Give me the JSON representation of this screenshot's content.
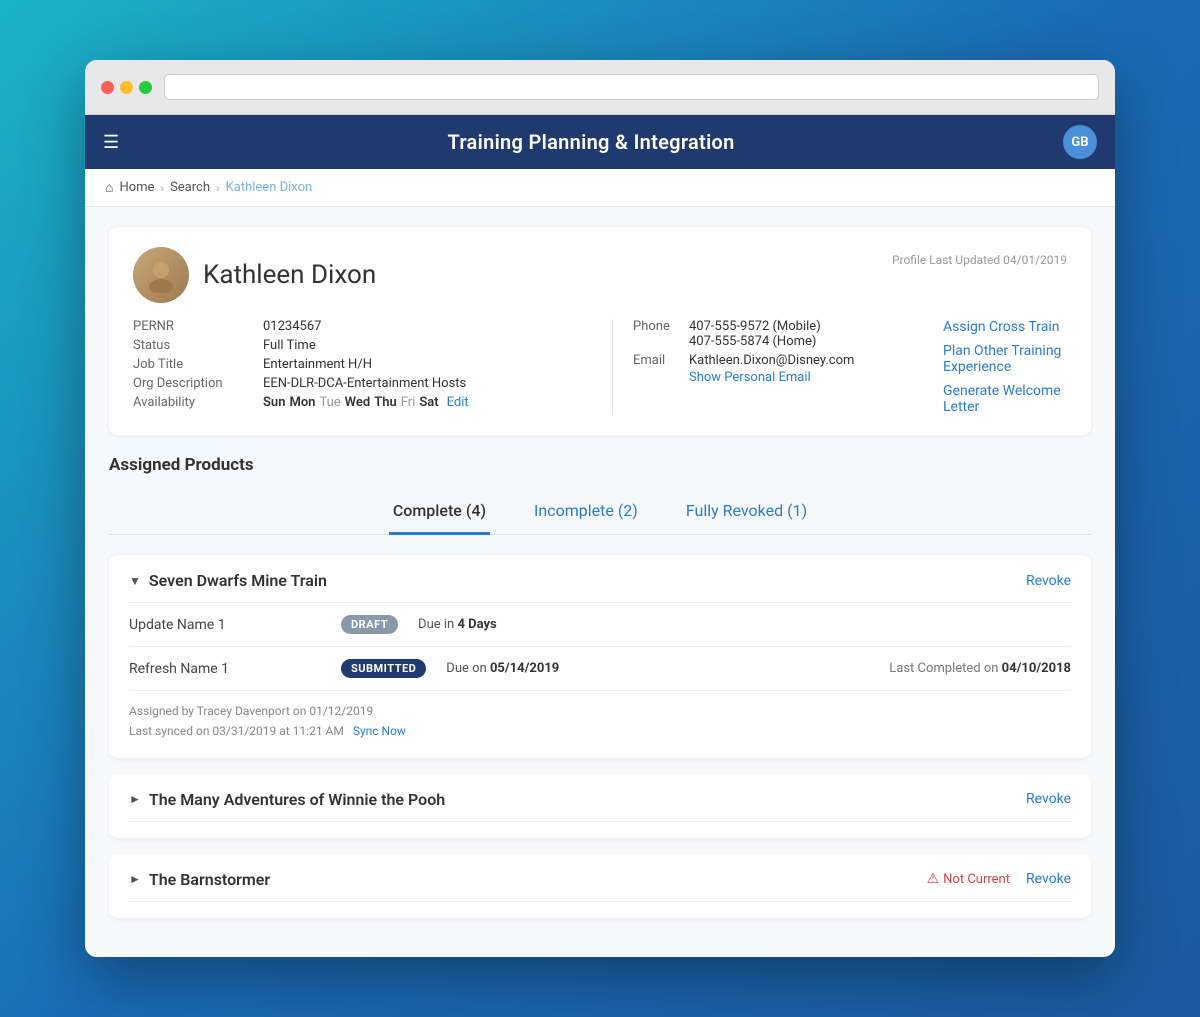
{
  "browser": {
    "dots": [
      "red",
      "yellow",
      "green"
    ]
  },
  "header": {
    "title": "Training Planning & Integration",
    "user_initials": "GB"
  },
  "breadcrumb": {
    "home": "Home",
    "search": "Search",
    "current": "Kathleen Dixon"
  },
  "profile": {
    "name": "Kathleen Dixon",
    "updated": "Profile Last Updated 04/01/2019",
    "pernr_label": "PERNR",
    "pernr_value": "01234567",
    "status_label": "Status",
    "status_value": "Full Time",
    "jobtitle_label": "Job Title",
    "jobtitle_value": "Entertainment H/H",
    "org_label": "Org Description",
    "org_value": "EEN-DLR-DCA-Entertainment Hosts",
    "availability_label": "Availability",
    "availability_days": [
      {
        "label": "Sun",
        "active": true
      },
      {
        "label": "Mon",
        "active": true
      },
      {
        "label": "Tue",
        "active": false
      },
      {
        "label": "Wed",
        "active": true
      },
      {
        "label": "Thu",
        "active": true
      },
      {
        "label": "Fri",
        "active": false
      },
      {
        "label": "Sat",
        "active": true
      }
    ],
    "edit_label": "Edit",
    "phone_label": "Phone",
    "phone_mobile": "407-555-9572 (Mobile)",
    "phone_home": "407-555-5874 (Home)",
    "email_label": "Email",
    "email_value": "Kathleen.Dixon@Disney.com",
    "show_personal_email": "Show Personal Email",
    "actions": [
      {
        "label": "Assign Cross Train",
        "key": "assign_cross_train"
      },
      {
        "label": "Plan Other Training Experience",
        "key": "plan_other"
      },
      {
        "label": "Generate Welcome Letter",
        "key": "generate_letter"
      }
    ]
  },
  "assigned_products": {
    "section_title": "Assigned Products",
    "tabs": [
      {
        "label": "Complete (4)",
        "key": "complete",
        "active": true
      },
      {
        "label": "Incomplete (2)",
        "key": "incomplete",
        "active": false
      },
      {
        "label": "Fully Revoked (1)",
        "key": "revoked",
        "active": false
      }
    ],
    "products": [
      {
        "name": "Seven Dwarfs Mine Train",
        "expanded": true,
        "revoke_label": "Revoke",
        "items": [
          {
            "name": "Update Name 1",
            "badge": "DRAFT",
            "badge_type": "draft",
            "due_text": "Due in",
            "due_value": "4 Days",
            "due_bold": true,
            "completed": ""
          },
          {
            "name": "Refresh Name 1",
            "badge": "SUBMITTED",
            "badge_type": "submitted",
            "due_text": "Due on",
            "due_value": "05/14/2019",
            "due_bold": true,
            "completed": "Last Completed on 04/10/2018",
            "completed_date": "04/10/2018"
          }
        ],
        "assigned_by": "Assigned by Tracey Davenport on 01/12/2019",
        "last_synced": "Last synced on 03/31/2019 at 11:21 AM",
        "sync_now": "Sync Now"
      },
      {
        "name": "The Many Adventures of Winnie the Pooh",
        "expanded": false,
        "revoke_label": "Revoke",
        "items": [],
        "not_current": false
      },
      {
        "name": "The Barnstormer",
        "expanded": false,
        "revoke_label": "Revoke",
        "items": [],
        "not_current": true,
        "not_current_label": "Not Current"
      }
    ]
  }
}
